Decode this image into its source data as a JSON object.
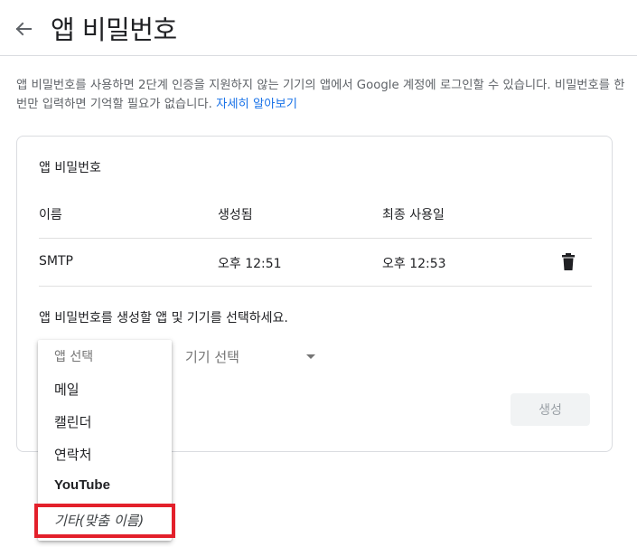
{
  "header": {
    "back_icon": "arrow-left-icon",
    "title": "앱 비밀번호"
  },
  "description": {
    "text": "앱 비밀번호를 사용하면 2단계 인증을 지원하지 않는 기기의 앱에서 Google 계정에 로그인할 수 있습니다. 비밀번호를 한 번만 입력하면 기억할 필요가 없습니다. ",
    "link_text": "자세히 알아보기"
  },
  "card": {
    "title": "앱 비밀번호",
    "columns": [
      "이름",
      "생성됨",
      "최종 사용일"
    ],
    "rows": [
      {
        "name": "SMTP",
        "created": "오후 12:51",
        "last_used": "오후 12:53",
        "delete_icon": "trash-icon"
      }
    ],
    "instruction": "앱 비밀번호를 생성할 앱 및 기기를 선택하세요.",
    "device_select": {
      "selected": "기기 선택",
      "icon": "caret-down-icon"
    },
    "generate_label": "생성"
  },
  "app_menu": {
    "items": [
      "앱 선택",
      "메일",
      "캘린더",
      "연락처",
      "YouTube",
      "기타(맞춤 이름)"
    ],
    "highlighted_item": "기타(맞춤 이름)",
    "highlight_color": "#e3202b"
  }
}
